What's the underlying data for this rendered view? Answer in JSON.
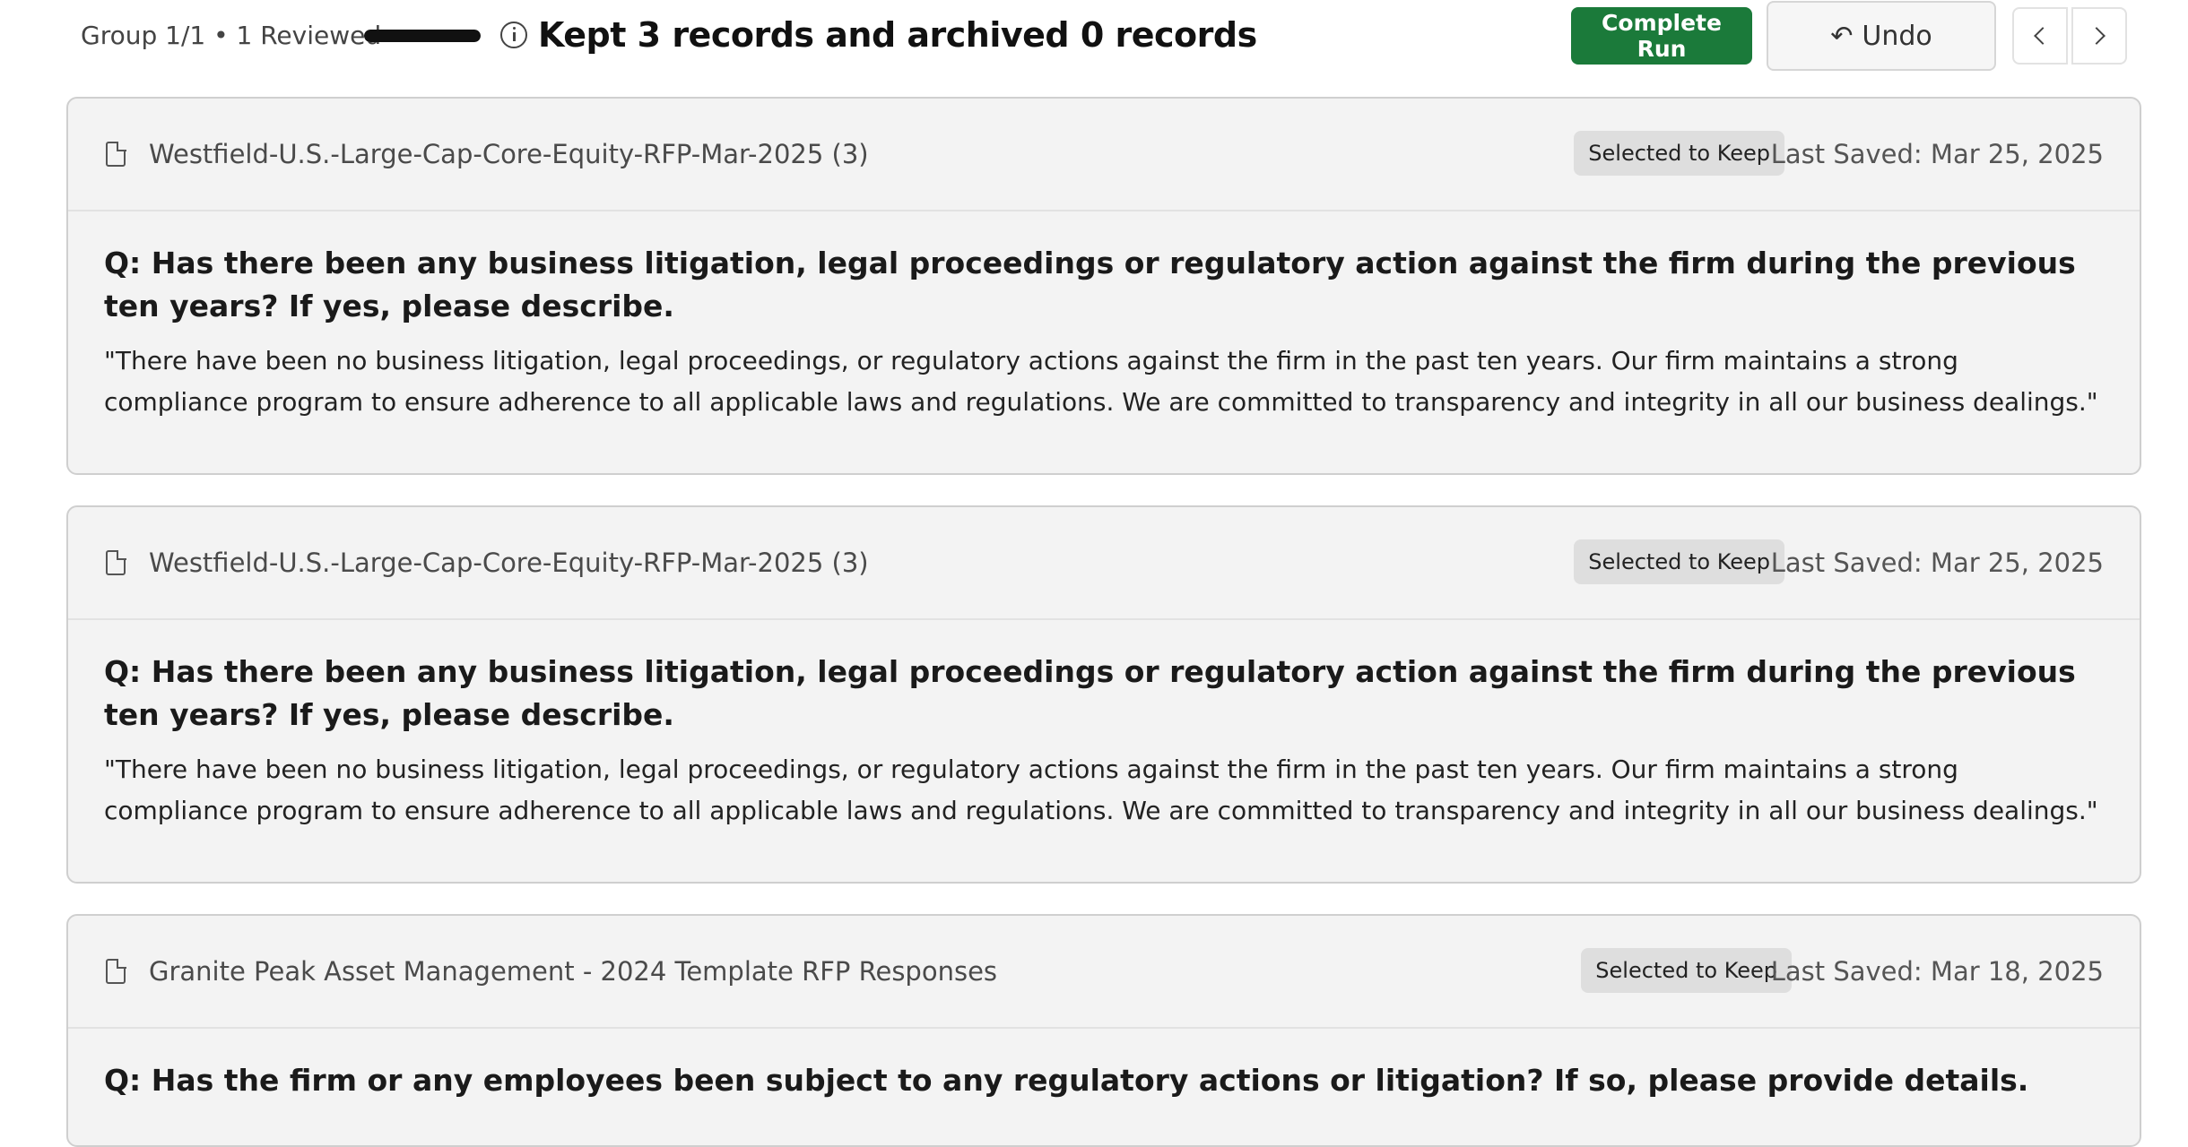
{
  "header": {
    "group_status": "Group 1/1 • 1 Reviewed",
    "progress_fraction": 1.0,
    "info_icon": "info-circle-icon",
    "summary": "Kept 3 records and archived 0 records",
    "complete_run_label": "Complete Run",
    "undo_label": "Undo",
    "undo_icon": "undo-arrow-icon",
    "prev_icon": "chevron-left-icon",
    "next_icon": "chevron-right-icon"
  },
  "colors": {
    "primary_green": "#1b7a3a",
    "card_background": "#f3f3f3",
    "badge_background": "#dedede"
  },
  "records": [
    {
      "file_name": "Westfield-U.S.-Large-Cap-Core-Equity-RFP-Mar-2025 (3)",
      "status_badge": "Selected to Keep",
      "last_saved": "Last Saved: Mar 25, 2025",
      "question": "Q: Has there been any business litigation, legal proceedings or regulatory action against the firm during the previous ten years? If yes, please describe.",
      "answer": "\"There have been no business litigation, legal proceedings, or regulatory actions against the firm in the past ten years. Our firm maintains a strong compliance program to ensure adherence to all applicable laws and regulations. We are committed to transparency and integrity in all our business dealings.\""
    },
    {
      "file_name": "Westfield-U.S.-Large-Cap-Core-Equity-RFP-Mar-2025 (3)",
      "status_badge": "Selected to Keep",
      "last_saved": "Last Saved: Mar 25, 2025",
      "question": "Q: Has there been any business litigation, legal proceedings or regulatory action against the firm during the previous ten years? If yes, please describe.",
      "answer": "\"There have been no business litigation, legal proceedings, or regulatory actions against the firm in the past ten years. Our firm maintains a strong compliance program to ensure adherence to all applicable laws and regulations. We are committed to transparency and integrity in all our business dealings.\""
    },
    {
      "file_name": "Granite Peak Asset Management - 2024 Template RFP Responses",
      "status_badge": "Selected to Keep",
      "last_saved": "Last Saved: Mar 18, 2025",
      "question": "Q: Has the firm or any employees been subject to any regulatory actions or litigation? If so, please provide details.",
      "answer": ""
    }
  ]
}
